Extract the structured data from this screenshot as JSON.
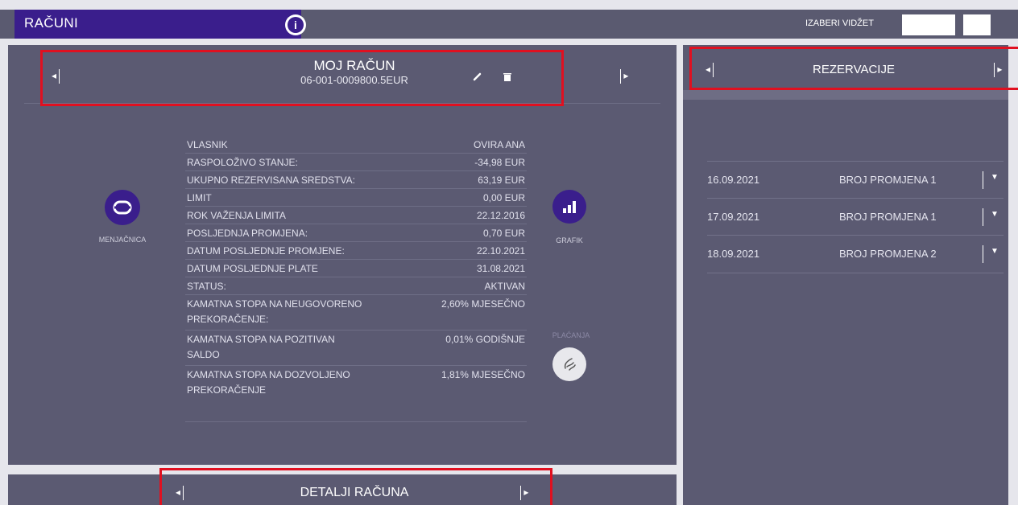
{
  "header": {
    "title": "RAČUNI",
    "info_glyph": "i",
    "widget_label": "IZABERI VIDŽET"
  },
  "account": {
    "title": "MOJ RAČUN",
    "number": "06-001-0009800.5EUR",
    "edit_icon": "pencil-icon",
    "delete_icon": "trash-icon"
  },
  "details": [
    {
      "label": "VLASNIK",
      "value": "OVIRA ANA"
    },
    {
      "label": "RASPOLOŽIVO STANJE:",
      "value": "-34,98 EUR"
    },
    {
      "label": "UKUPNO REZERVISANA SREDSTVA:",
      "value": "63,19 EUR"
    },
    {
      "label": "LIMIT",
      "value": "0,00 EUR"
    },
    {
      "label": "ROK VAŽENJA LIMITA",
      "value": "22.12.2016"
    },
    {
      "label": "POSLJEDNJA PROMJENA:",
      "value": "0,70 EUR"
    },
    {
      "label": "DATUM POSLJEDNJE PROMJENE:",
      "value": "22.10.2021"
    },
    {
      "label": "DATUM POSLJEDNJE PLATE",
      "value": "31.08.2021"
    },
    {
      "label": "STATUS:",
      "value": "AKTIVAN"
    },
    {
      "label": "KAMATNA STOPA NA NEUGOVORENO",
      "label2": "PREKORAČENJE:",
      "value": "2,60% MJESEČNO"
    },
    {
      "label": "KAMATNA STOPA NA POZITIVAN",
      "label2": "SALDO",
      "value": "0,01% GODIŠNJE"
    },
    {
      "label": "KAMATNA STOPA NA DOZVOLJENO",
      "label2": "PREKORAČENJE",
      "value": "1,81% MJESEČNO"
    }
  ],
  "actions": {
    "exchange_label": "MENJAČNICA",
    "chart_label": "GRAFIK",
    "payments_label": "PLAĆANJA"
  },
  "bottom": {
    "title": "DETALJI RAČUNA"
  },
  "reservations": {
    "title": "REZERVACIJE",
    "rows": [
      {
        "date": "16.09.2021",
        "desc": "BROJ PROMJENA 1"
      },
      {
        "date": "17.09.2021",
        "desc": "BROJ PROMJENA 1"
      },
      {
        "date": "18.09.2021",
        "desc": "BROJ PROMJENA 2"
      }
    ]
  },
  "colors": {
    "brand_purple": "#3a1e8c",
    "panel": "#5b5a72",
    "highlight_red": "#e01020"
  }
}
